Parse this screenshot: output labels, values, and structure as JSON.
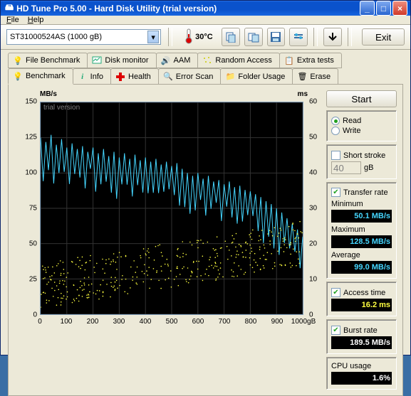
{
  "window": {
    "title": "HD Tune Pro 5.00 - Hard Disk Utility (trial version)"
  },
  "menu": {
    "file": "File",
    "help": "Help"
  },
  "toolbar": {
    "drive": "ST31000524AS (1000 gB)",
    "temperature": "30°C",
    "exit": "Exit"
  },
  "tabs_top": {
    "file_benchmark": "File Benchmark",
    "disk_monitor": "Disk monitor",
    "aam": "AAM",
    "random_access": "Random Access",
    "extra_tests": "Extra tests"
  },
  "tabs_bottom": {
    "benchmark": "Benchmark",
    "info": "Info",
    "health": "Health",
    "error_scan": "Error Scan",
    "folder_usage": "Folder Usage",
    "erase": "Erase"
  },
  "side": {
    "start": "Start",
    "read": "Read",
    "write": "Write",
    "short_stroke": "Short stroke",
    "short_stroke_val": "40",
    "short_stroke_unit": "gB",
    "transfer_rate": "Transfer rate",
    "minimum": "Minimum",
    "minimum_val": "50.1",
    "maximum": "Maximum",
    "maximum_val": "128.5",
    "average": "Average",
    "average_val": "99.0",
    "mbs": "MB/s",
    "access_time": "Access time",
    "access_val": "16.2",
    "ms": "ms",
    "burst_rate": "Burst rate",
    "burst_val": "189.5",
    "cpu_usage": "CPU usage",
    "cpu_val": "1.6%"
  },
  "chart": {
    "watermark": "trial version",
    "ylabel_left": "MB/s",
    "ylabel_right": "ms",
    "xunit": "gB"
  },
  "chart_data": {
    "type": "line+scatter",
    "title": "",
    "x_range": [
      0,
      1000
    ],
    "x_ticks": [
      0,
      100,
      200,
      300,
      400,
      500,
      600,
      700,
      800,
      900,
      1000
    ],
    "y_left_range": [
      0,
      150
    ],
    "y_left_ticks": [
      0,
      25,
      50,
      75,
      100,
      125,
      150
    ],
    "y_right_range": [
      0,
      60
    ],
    "y_right_ticks": [
      0,
      10,
      20,
      30,
      40,
      50,
      60
    ],
    "series": [
      {
        "name": "Transfer rate",
        "axis": "left",
        "color": "#45d6ff",
        "x": [
          0,
          20,
          40,
          60,
          80,
          100,
          120,
          140,
          160,
          180,
          200,
          220,
          240,
          260,
          280,
          300,
          320,
          340,
          360,
          380,
          400,
          420,
          440,
          460,
          480,
          500,
          520,
          540,
          560,
          580,
          600,
          620,
          640,
          660,
          680,
          700,
          720,
          740,
          760,
          780,
          800,
          820,
          840,
          860,
          880,
          900,
          920,
          940,
          960,
          980,
          1000
        ],
        "y": [
          125,
          122,
          127,
          120,
          124,
          118,
          121,
          117,
          119,
          115,
          118,
          114,
          117,
          112,
          115,
          111,
          114,
          110,
          113,
          109,
          111,
          108,
          110,
          106,
          108,
          105,
          107,
          103,
          100,
          98,
          100,
          96,
          98,
          94,
          95,
          92,
          94,
          90,
          91,
          88,
          87,
          85,
          83,
          80,
          78,
          75,
          72,
          68,
          64,
          60,
          55
        ]
      },
      {
        "name": "Access time",
        "axis": "right",
        "color": "#ffff40",
        "type": "scatter",
        "approx_trend_x": [
          0,
          100,
          200,
          300,
          400,
          500,
          600,
          700,
          800,
          900,
          1000
        ],
        "approx_trend_y": [
          8,
          10,
          12,
          13,
          14,
          15,
          16,
          17,
          18,
          19,
          20
        ],
        "spread_ms": 8
      }
    ]
  }
}
